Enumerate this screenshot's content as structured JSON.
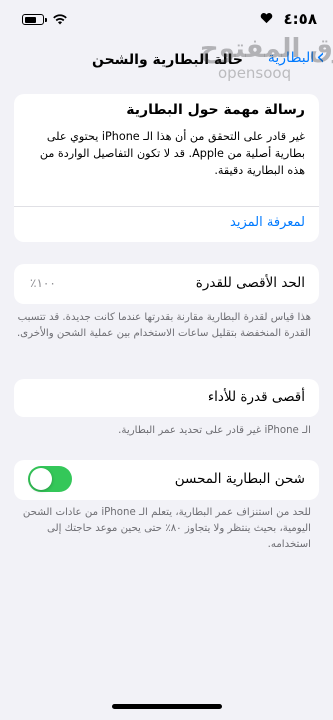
{
  "status_bar": {
    "time": "٤:٥٨",
    "icons": [
      "battery-icon",
      "wifi-icon",
      "heart-icon"
    ]
  },
  "nav": {
    "back_label": "البطارية",
    "title": "حالة البطارية والشحن"
  },
  "watermark": {
    "text": "السوق المفتوح",
    "sub": "opensooq"
  },
  "message_card": {
    "title": "رسالة مهمة حول البطارية",
    "body": "غير قادر على التحقق من أن هذا الـ iPhone يحتوي على بطارية أصلية من Apple. قد لا تكون التفاصيل الواردة من هذه البطارية دقيقة.",
    "link": "لمعرفة المزيد"
  },
  "max_capacity": {
    "label": "الحد الأقصى للقدرة",
    "value": "١٠٠٪",
    "footnote": "هذا قياس لقدرة البطارية مقارنة بقدرتها عندما كانت جديدة. قد تتسبب القدرة المنخفضة بتقليل ساعات الاستخدام بين عملية الشحن والأخرى."
  },
  "peak_performance": {
    "label": "أقصى قدرة للأداء",
    "footnote": "الـ iPhone غير قادر على تحديد عمر البطارية."
  },
  "optimized_charging": {
    "label": "شحن البطارية المحسن",
    "enabled": true,
    "toggle_color": "#34c759",
    "footnote": "للحد من استنزاف عمر البطارية، يتعلم الـ iPhone من عادات الشحن اليومية، بحيث ينتظر ولا يتجاوز ٨٠٪ حتى يحين موعد حاجتك إلى استخدامه."
  },
  "colors": {
    "accent": "#007aff",
    "background": "#f2f2f7",
    "secondary_text": "#6d6d72"
  }
}
